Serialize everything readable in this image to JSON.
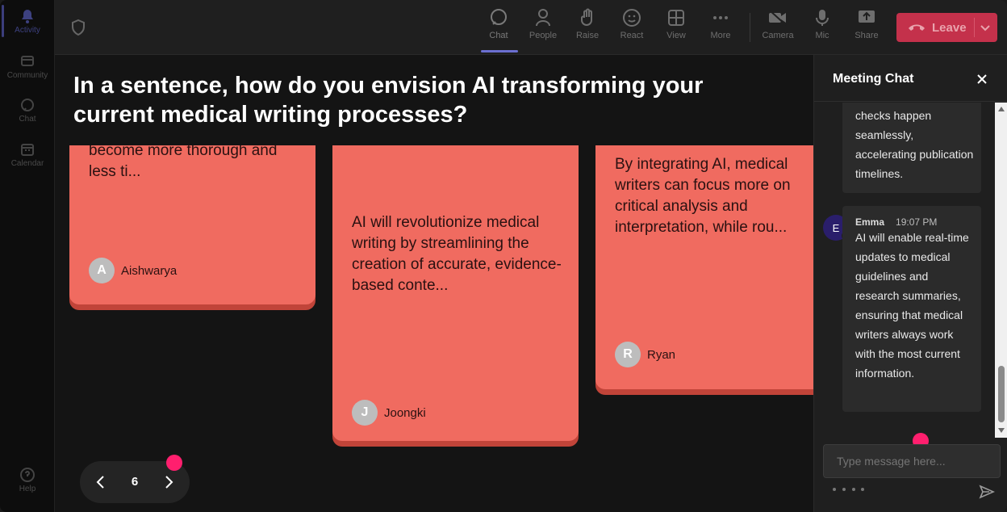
{
  "rail": {
    "items": [
      {
        "label": "Activity"
      },
      {
        "label": "Community"
      },
      {
        "label": "Chat"
      },
      {
        "label": "Calendar"
      }
    ],
    "help_label": "Help"
  },
  "toolbar": {
    "items": [
      {
        "label": "Chat"
      },
      {
        "label": "People"
      },
      {
        "label": "Raise"
      },
      {
        "label": "React"
      },
      {
        "label": "View"
      },
      {
        "label": "More"
      },
      {
        "label": "Camera"
      },
      {
        "label": "Mic"
      },
      {
        "label": "Share"
      }
    ],
    "leave_label": "Leave",
    "leave_color": "#c4314b"
  },
  "main": {
    "question": "In a sentence, how do you envision AI transforming your current medical writing processes?",
    "cards": [
      {
        "text": "become more thorough and less ti...",
        "initial": "A",
        "author": "Aishwarya"
      },
      {
        "text": "AI will revolutionize medical writing by streamlining the creation of accurate, evidence-based conte...",
        "initial": "J",
        "author": "Joongki"
      },
      {
        "text": "By integrating AI, medical writers can focus more on critical analysis and interpretation, while rou...",
        "initial": "R",
        "author": "Ryan"
      }
    ],
    "card_color": "#f06b60",
    "page_number": "6"
  },
  "chat": {
    "title": "Meeting Chat",
    "messages": [
      {
        "text": "checks happen seamlessly, accelerating publication timelines."
      },
      {
        "initial": "E",
        "author": "Emma",
        "time": "19:07 PM",
        "text": "AI will enable real-time updates to medical guidelines and research summaries, ensuring that medical writers always work with the most current information."
      }
    ],
    "input_placeholder": "Type message here..."
  }
}
